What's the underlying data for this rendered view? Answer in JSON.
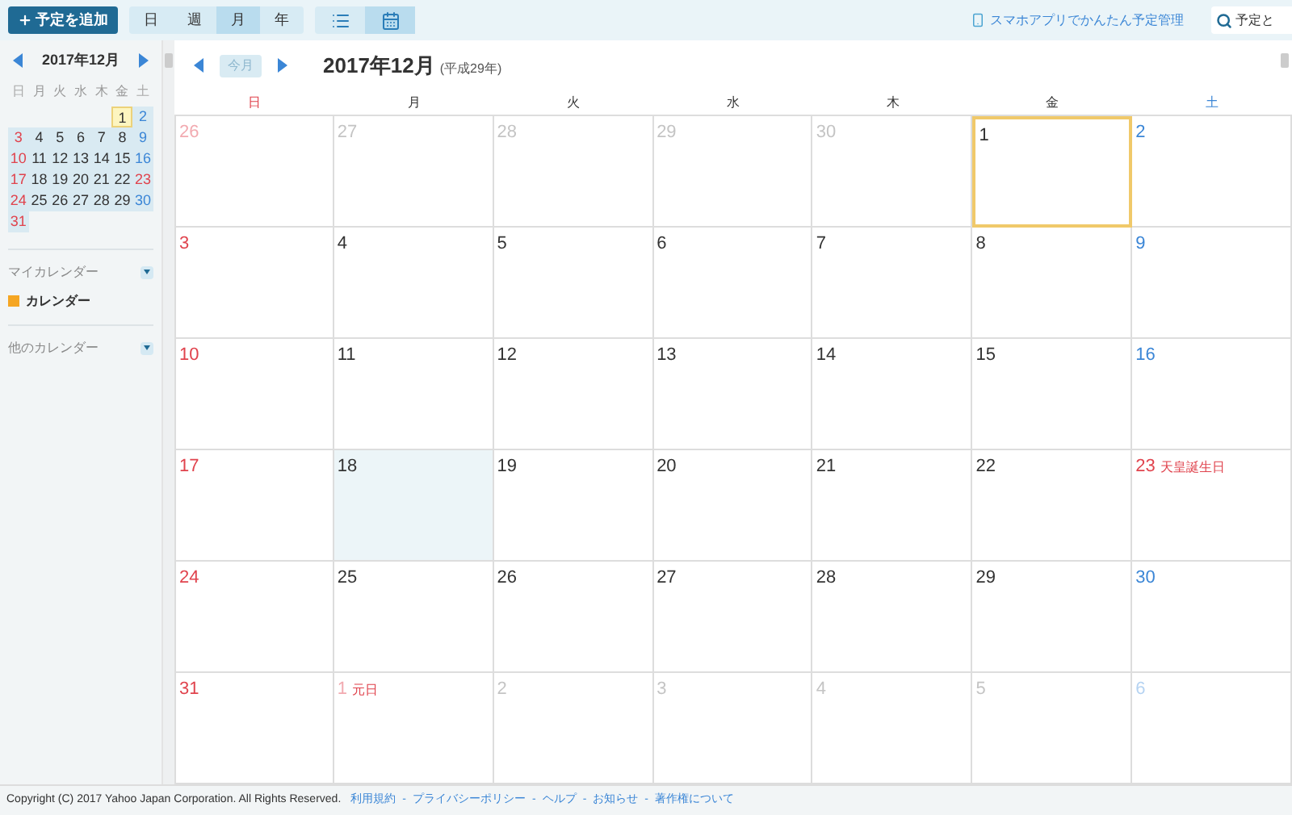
{
  "toolbar": {
    "add_button": "予定を追加",
    "views": [
      {
        "label": "日",
        "selected": false
      },
      {
        "label": "週",
        "selected": false
      },
      {
        "label": "月",
        "selected": true
      },
      {
        "label": "年",
        "selected": false
      }
    ],
    "modes": [
      {
        "kind": "list",
        "selected": false
      },
      {
        "kind": "calendar",
        "selected": true
      }
    ],
    "app_link": "スマホアプリでかんたん予定管理",
    "search": {
      "placeholder": "予定と"
    }
  },
  "mini_calendar": {
    "title": "2017年12月",
    "weekdays": [
      {
        "label": "日",
        "kind": "sun"
      },
      {
        "label": "月",
        "kind": "weekday"
      },
      {
        "label": "火",
        "kind": "weekday"
      },
      {
        "label": "水",
        "kind": "weekday"
      },
      {
        "label": "木",
        "kind": "weekday"
      },
      {
        "label": "金",
        "kind": "weekday"
      },
      {
        "label": "土",
        "kind": "sat"
      }
    ],
    "weeks": [
      [
        {
          "kind": "blank"
        },
        {
          "kind": "blank"
        },
        {
          "kind": "blank"
        },
        {
          "kind": "blank"
        },
        {
          "kind": "blank"
        },
        {
          "day": "1",
          "kind": "weekday",
          "today": true
        },
        {
          "day": "2",
          "kind": "sat",
          "today": false
        }
      ],
      [
        {
          "day": "3",
          "kind": "sun",
          "today": false
        },
        {
          "day": "4",
          "kind": "weekday",
          "today": false
        },
        {
          "day": "5",
          "kind": "weekday",
          "today": false
        },
        {
          "day": "6",
          "kind": "weekday",
          "today": false
        },
        {
          "day": "7",
          "kind": "weekday",
          "today": false
        },
        {
          "day": "8",
          "kind": "weekday",
          "today": false
        },
        {
          "day": "9",
          "kind": "sat",
          "today": false
        }
      ],
      [
        {
          "day": "10",
          "kind": "sun",
          "today": false
        },
        {
          "day": "11",
          "kind": "weekday",
          "today": false
        },
        {
          "day": "12",
          "kind": "weekday",
          "today": false
        },
        {
          "day": "13",
          "kind": "weekday",
          "today": false
        },
        {
          "day": "14",
          "kind": "weekday",
          "today": false
        },
        {
          "day": "15",
          "kind": "weekday",
          "today": false
        },
        {
          "day": "16",
          "kind": "sat",
          "today": false
        }
      ],
      [
        {
          "day": "17",
          "kind": "sun",
          "today": false
        },
        {
          "day": "18",
          "kind": "weekday",
          "today": false
        },
        {
          "day": "19",
          "kind": "weekday",
          "today": false
        },
        {
          "day": "20",
          "kind": "weekday",
          "today": false
        },
        {
          "day": "21",
          "kind": "weekday",
          "today": false
        },
        {
          "day": "22",
          "kind": "weekday",
          "today": false
        },
        {
          "day": "23",
          "kind": "sun",
          "today": false
        }
      ],
      [
        {
          "day": "24",
          "kind": "sun",
          "today": false
        },
        {
          "day": "25",
          "kind": "weekday",
          "today": false
        },
        {
          "day": "26",
          "kind": "weekday",
          "today": false
        },
        {
          "day": "27",
          "kind": "weekday",
          "today": false
        },
        {
          "day": "28",
          "kind": "weekday",
          "today": false
        },
        {
          "day": "29",
          "kind": "weekday",
          "today": false
        },
        {
          "day": "30",
          "kind": "sat",
          "today": false
        }
      ],
      [
        {
          "day": "31",
          "kind": "sun",
          "today": false
        },
        {
          "kind": "blank"
        },
        {
          "kind": "blank"
        },
        {
          "kind": "blank"
        },
        {
          "kind": "blank"
        },
        {
          "kind": "blank"
        },
        {
          "kind": "blank"
        }
      ]
    ]
  },
  "my_calendars": {
    "title": "マイカレンダー",
    "items": [
      {
        "label": "カレンダー",
        "color": "#f5a623"
      }
    ]
  },
  "other_calendars": {
    "title": "他のカレンダー"
  },
  "header": {
    "today_button": "今月",
    "title": "2017年12月",
    "era": "(平成29年)"
  },
  "weekdays": [
    {
      "label": "日",
      "kind": "sun"
    },
    {
      "label": "月",
      "kind": "weekday"
    },
    {
      "label": "火",
      "kind": "weekday"
    },
    {
      "label": "水",
      "kind": "weekday"
    },
    {
      "label": "木",
      "kind": "weekday"
    },
    {
      "label": "金",
      "kind": "weekday"
    },
    {
      "label": "土",
      "kind": "sat"
    }
  ],
  "weeks": [
    [
      {
        "day": "26",
        "kind": "sun",
        "in_month": false,
        "today": false,
        "selected": false
      },
      {
        "day": "27",
        "kind": "weekday",
        "in_month": false,
        "today": false,
        "selected": false
      },
      {
        "day": "28",
        "kind": "weekday",
        "in_month": false,
        "today": false,
        "selected": false
      },
      {
        "day": "29",
        "kind": "weekday",
        "in_month": false,
        "today": false,
        "selected": false
      },
      {
        "day": "30",
        "kind": "weekday",
        "in_month": false,
        "today": false,
        "selected": false
      },
      {
        "day": "1",
        "kind": "weekday",
        "in_month": true,
        "today": true,
        "selected": false
      },
      {
        "day": "2",
        "kind": "sat",
        "in_month": true,
        "today": false,
        "selected": false
      }
    ],
    [
      {
        "day": "3",
        "kind": "sun",
        "in_month": true,
        "today": false,
        "selected": false
      },
      {
        "day": "4",
        "kind": "weekday",
        "in_month": true,
        "today": false,
        "selected": false
      },
      {
        "day": "5",
        "kind": "weekday",
        "in_month": true,
        "today": false,
        "selected": false
      },
      {
        "day": "6",
        "kind": "weekday",
        "in_month": true,
        "today": false,
        "selected": false
      },
      {
        "day": "7",
        "kind": "weekday",
        "in_month": true,
        "today": false,
        "selected": false
      },
      {
        "day": "8",
        "kind": "weekday",
        "in_month": true,
        "today": false,
        "selected": false
      },
      {
        "day": "9",
        "kind": "sat",
        "in_month": true,
        "today": false,
        "selected": false
      }
    ],
    [
      {
        "day": "10",
        "kind": "sun",
        "in_month": true,
        "today": false,
        "selected": false
      },
      {
        "day": "11",
        "kind": "weekday",
        "in_month": true,
        "today": false,
        "selected": false
      },
      {
        "day": "12",
        "kind": "weekday",
        "in_month": true,
        "today": false,
        "selected": false
      },
      {
        "day": "13",
        "kind": "weekday",
        "in_month": true,
        "today": false,
        "selected": false
      },
      {
        "day": "14",
        "kind": "weekday",
        "in_month": true,
        "today": false,
        "selected": false
      },
      {
        "day": "15",
        "kind": "weekday",
        "in_month": true,
        "today": false,
        "selected": false
      },
      {
        "day": "16",
        "kind": "sat",
        "in_month": true,
        "today": false,
        "selected": false
      }
    ],
    [
      {
        "day": "17",
        "kind": "sun",
        "in_month": true,
        "today": false,
        "selected": false
      },
      {
        "day": "18",
        "kind": "weekday",
        "in_month": true,
        "today": false,
        "selected": true
      },
      {
        "day": "19",
        "kind": "weekday",
        "in_month": true,
        "today": false,
        "selected": false
      },
      {
        "day": "20",
        "kind": "weekday",
        "in_month": true,
        "today": false,
        "selected": false
      },
      {
        "day": "21",
        "kind": "weekday",
        "in_month": true,
        "today": false,
        "selected": false
      },
      {
        "day": "22",
        "kind": "weekday",
        "in_month": true,
        "today": false,
        "selected": false
      },
      {
        "day": "23",
        "kind": "holiday",
        "in_month": true,
        "today": false,
        "selected": false,
        "holiday": "天皇誕生日"
      }
    ],
    [
      {
        "day": "24",
        "kind": "sun",
        "in_month": true,
        "today": false,
        "selected": false
      },
      {
        "day": "25",
        "kind": "weekday",
        "in_month": true,
        "today": false,
        "selected": false
      },
      {
        "day": "26",
        "kind": "weekday",
        "in_month": true,
        "today": false,
        "selected": false
      },
      {
        "day": "27",
        "kind": "weekday",
        "in_month": true,
        "today": false,
        "selected": false
      },
      {
        "day": "28",
        "kind": "weekday",
        "in_month": true,
        "today": false,
        "selected": false
      },
      {
        "day": "29",
        "kind": "weekday",
        "in_month": true,
        "today": false,
        "selected": false
      },
      {
        "day": "30",
        "kind": "sat",
        "in_month": true,
        "today": false,
        "selected": false
      }
    ],
    [
      {
        "day": "31",
        "kind": "sun",
        "in_month": true,
        "today": false,
        "selected": false
      },
      {
        "day": "1",
        "kind": "holiday",
        "in_month": false,
        "today": false,
        "selected": false,
        "holiday": "元日"
      },
      {
        "day": "2",
        "kind": "weekday",
        "in_month": false,
        "today": false,
        "selected": false
      },
      {
        "day": "3",
        "kind": "weekday",
        "in_month": false,
        "today": false,
        "selected": false
      },
      {
        "day": "4",
        "kind": "weekday",
        "in_month": false,
        "today": false,
        "selected": false
      },
      {
        "day": "5",
        "kind": "weekday",
        "in_month": false,
        "today": false,
        "selected": false
      },
      {
        "day": "6",
        "kind": "sat",
        "in_month": false,
        "today": false,
        "selected": false
      }
    ]
  ],
  "footer": {
    "copyright": "Copyright (C) 2017 Yahoo Japan Corporation. All Rights Reserved.",
    "separator": "-",
    "links": [
      "利用規約",
      "プライバシーポリシー",
      "ヘルプ",
      "お知らせ",
      "著作権について"
    ]
  }
}
